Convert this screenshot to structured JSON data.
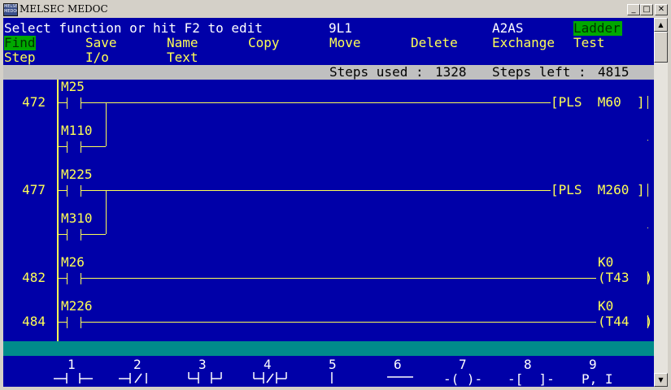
{
  "window": {
    "title": "MELSEC MEDOC",
    "icon_label": "MELSEC MEDOC",
    "minimize": "_",
    "maximize": "□",
    "close": "✕"
  },
  "header": {
    "prompt": "Select function or hit F2 to edit",
    "program_name": "9L1",
    "cpu_type": "A2AS",
    "mode": "Ladder"
  },
  "menu": {
    "row1": [
      "Find",
      "Save",
      "Name",
      "Copy",
      "Move",
      "Delete",
      "Exchange",
      "Test"
    ],
    "row2": [
      "Step",
      "I/o",
      "Text"
    ]
  },
  "status": {
    "steps_used_label": "Steps used : ",
    "steps_used": "1328",
    "steps_left_label": "Steps left : ",
    "steps_left": "4815"
  },
  "rungs": [
    {
      "step": "472",
      "contacts": [
        "M25",
        "M110"
      ],
      "instruction": "[PLS  M60  ]",
      "constant": ""
    },
    {
      "step": "477",
      "contacts": [
        "M225",
        "M310"
      ],
      "instruction": "[PLS  M260 ]",
      "constant": ""
    },
    {
      "step": "482",
      "contacts": [
        "M26"
      ],
      "instruction": "(T43  )",
      "constant": "K0"
    },
    {
      "step": "484",
      "contacts": [
        "M226"
      ],
      "instruction": "(T44  )",
      "constant": "K0"
    }
  ],
  "function_keys": [
    {
      "num": "1",
      "symbol": "normally-open-contact"
    },
    {
      "num": "2",
      "symbol": "normally-closed-contact"
    },
    {
      "num": "3",
      "symbol": "parallel-open-contact"
    },
    {
      "num": "4",
      "symbol": "parallel-closed-contact"
    },
    {
      "num": "5",
      "symbol": "vertical-line"
    },
    {
      "num": "6",
      "symbol": "horizontal-line"
    },
    {
      "num": "7",
      "symbol": "output-coil",
      "text": "-( )-"
    },
    {
      "num": "8",
      "symbol": "application-instruction",
      "text": "-[  ]-"
    },
    {
      "num": "9",
      "symbol": "pointer-label",
      "text": "P, I"
    }
  ],
  "colors": {
    "screen_bg": "#0000a8",
    "ladder": "#ffff55",
    "highlight": "#00a800",
    "status_bg": "#c0c0c0",
    "cyan_bar": "#008b8b"
  }
}
